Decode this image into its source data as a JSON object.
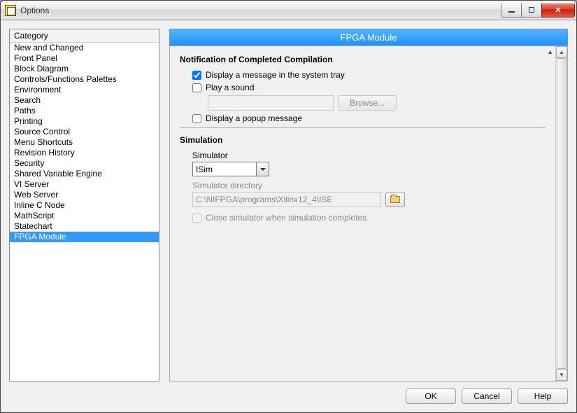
{
  "window": {
    "title": "Options"
  },
  "category": {
    "header": "Category",
    "items": [
      "New and Changed",
      "Front Panel",
      "Block Diagram",
      "Controls/Functions Palettes",
      "Environment",
      "Search",
      "Paths",
      "Printing",
      "Source Control",
      "Menu Shortcuts",
      "Revision History",
      "Security",
      "Shared Variable Engine",
      "VI Server",
      "Web Server",
      "Inline C Node",
      "MathScript",
      "Statechart",
      "FPGA Module"
    ],
    "selected_index": 18
  },
  "page": {
    "title": "FPGA Module",
    "notification": {
      "section_title": "Notification of Completed Compilation",
      "display_tray": {
        "label": "Display a message in the system tray",
        "checked": true
      },
      "play_sound": {
        "label": "Play a sound",
        "checked": false
      },
      "sound_path": "",
      "browse_label": "Browse...",
      "display_popup": {
        "label": "Display a popup message",
        "checked": false
      }
    },
    "simulation": {
      "section_title": "Simulation",
      "simulator_label": "Simulator",
      "simulator_value": "ISim",
      "simulator_dir_label": "Simulator directory",
      "simulator_dir_value": "C:\\NIFPGA\\programs\\Xilinx12_4\\ISE",
      "close_sim": {
        "label": "Close simulator when simulation completes",
        "checked": false
      }
    }
  },
  "buttons": {
    "ok": "OK",
    "cancel": "Cancel",
    "help": "Help"
  }
}
